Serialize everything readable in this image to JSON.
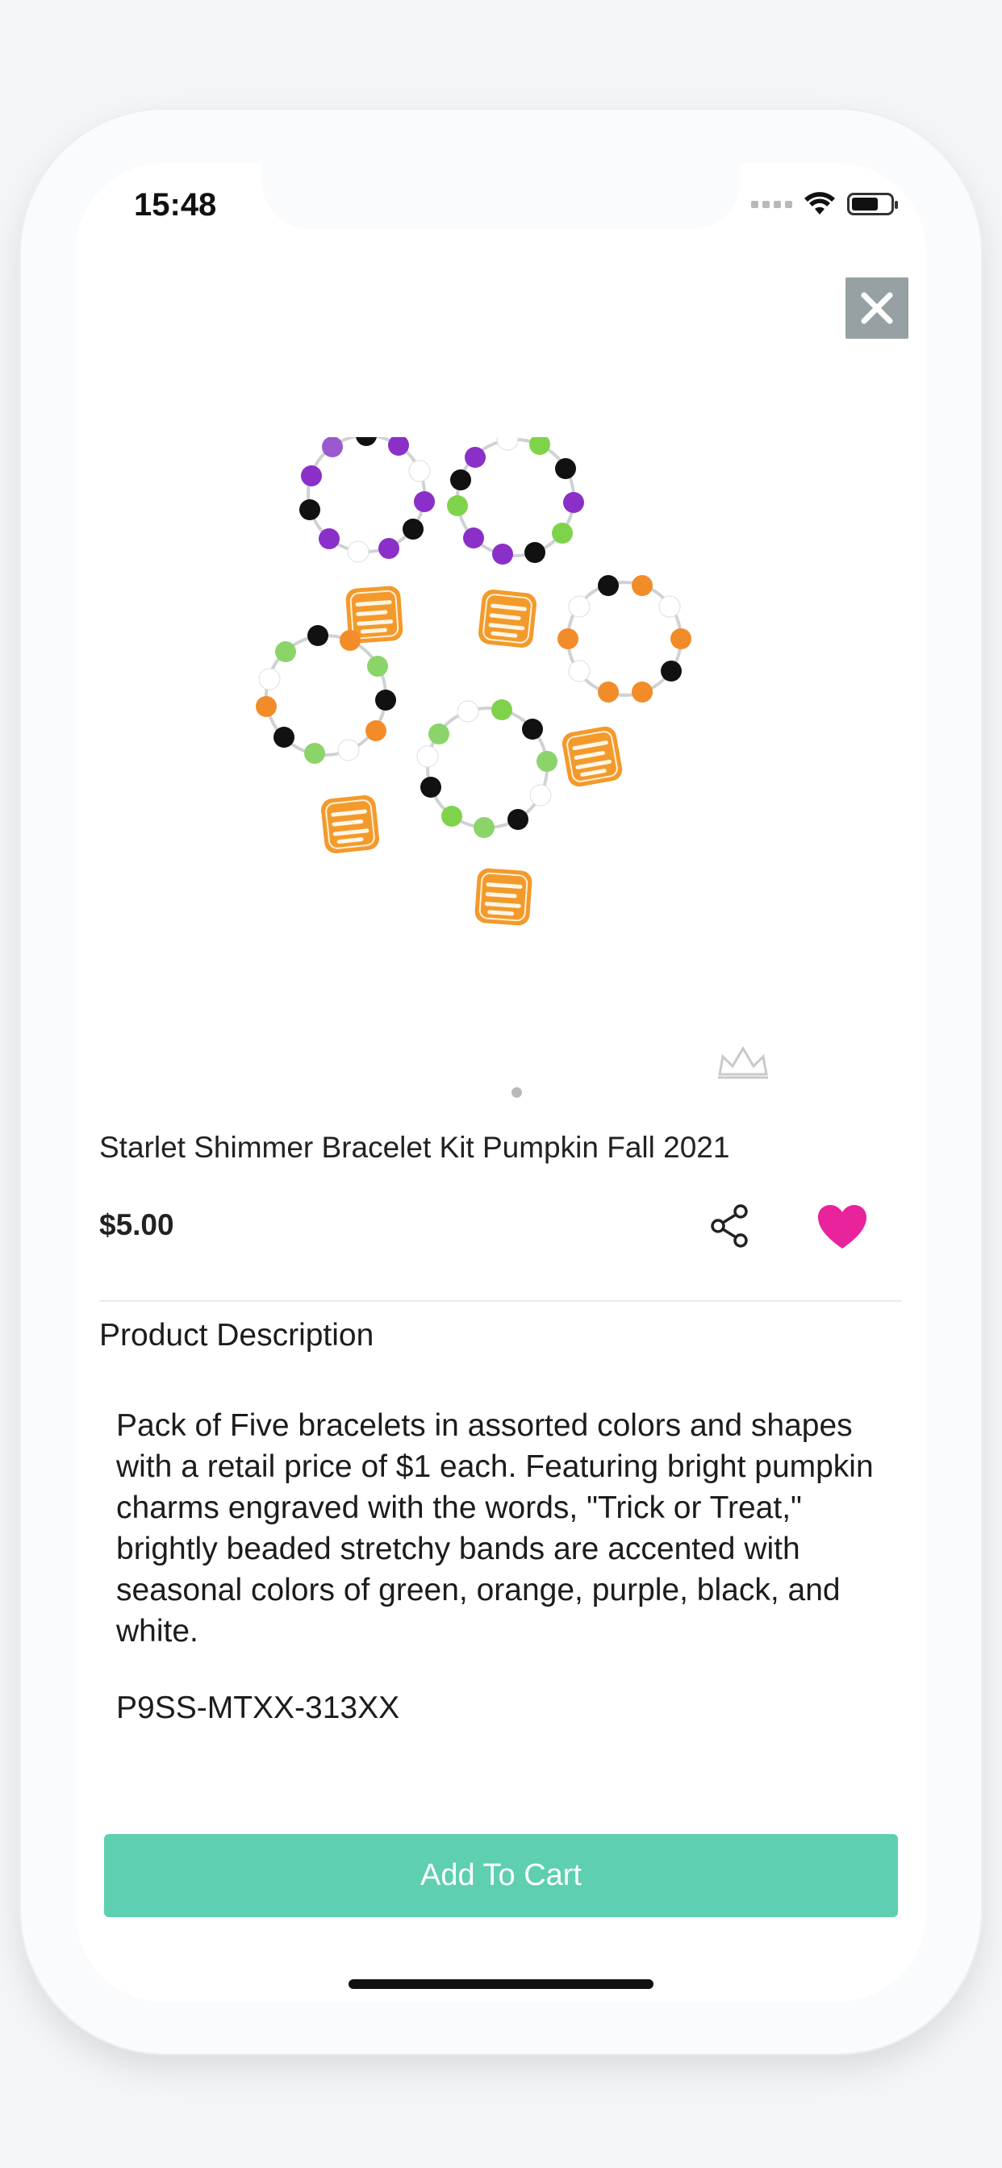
{
  "status_bar": {
    "time": "15:48"
  },
  "product": {
    "title": "Starlet Shimmer Bracelet Kit Pumpkin Fall 2021",
    "price": "$5.00",
    "description_heading": "Product Description",
    "description": "Pack of Five bracelets in assorted colors and shapes with a retail price of $1 each. Featuring bright pumpkin charms engraved with the words, \"Trick or Treat,\" brightly beaded stretchy bands are accented with seasonal colors of green, orange, purple, black, and white.",
    "sku": "P9SS-MTXX-313XX",
    "image_alt": "five beaded bracelets with Trick or Treat pumpkin charms",
    "charm_text": "Trick or Treat"
  },
  "actions": {
    "add_to_cart_label": "Add To Cart"
  },
  "carousel": {
    "current_page": 1,
    "page_count": 1
  },
  "colors": {
    "accent_green": "#5ecfb1",
    "heart_pink": "#e8239c",
    "close_button": "#97a1a3"
  },
  "icons": {
    "close": "close-icon",
    "share": "share-icon",
    "favorite": "heart-icon",
    "watermark": "crown-logo-icon"
  }
}
